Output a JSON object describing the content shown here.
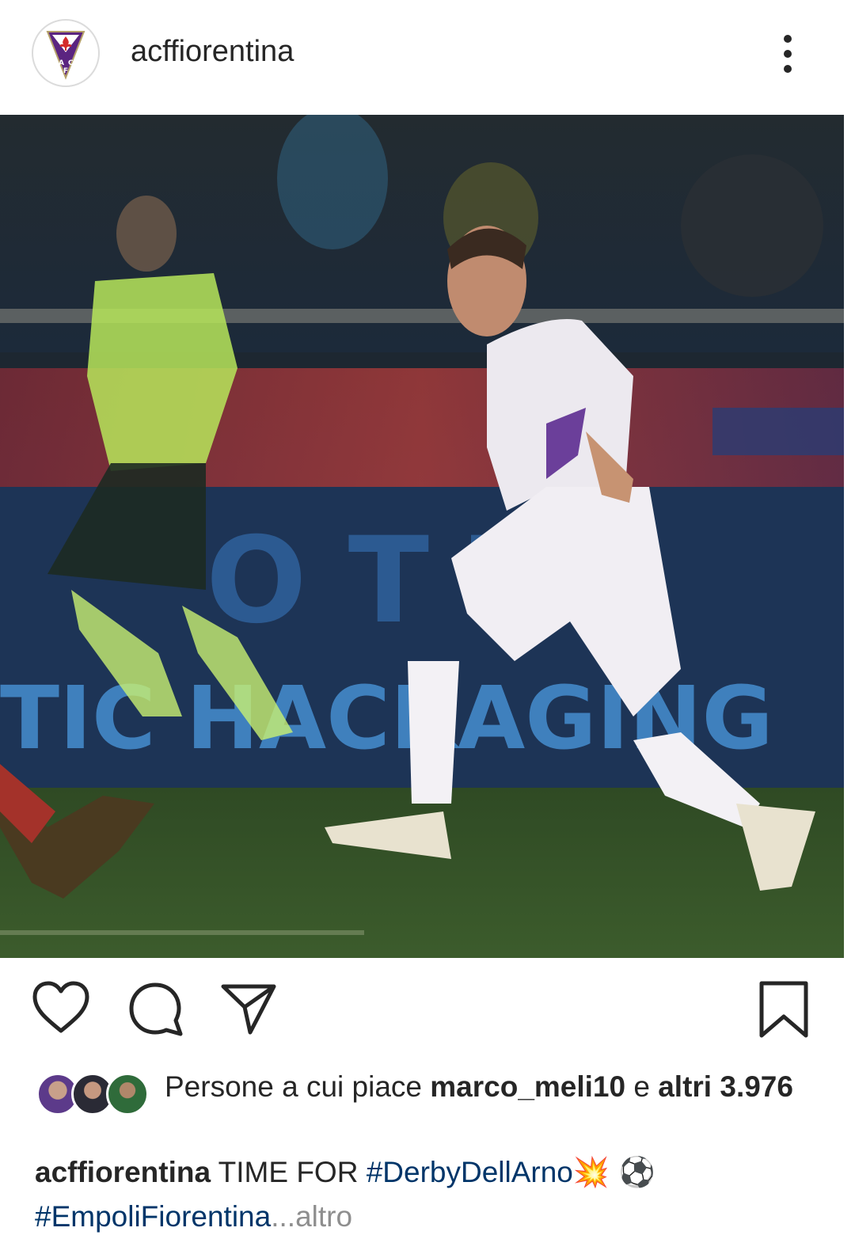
{
  "header": {
    "username": "acffiorentina",
    "avatar_icon": "fiorentina-crest-icon",
    "more_icon": "more-vertical-icon"
  },
  "post": {
    "image_alt": "Fiorentina player in white kit running on pitch",
    "colors": {
      "accent": "#6b2c91",
      "hashtag": "#003569",
      "muted": "#8e8e8e"
    }
  },
  "actions": {
    "like_icon": "heart-icon",
    "comment_icon": "comment-icon",
    "share_icon": "send-icon",
    "save_icon": "bookmark-icon"
  },
  "likes": {
    "prefix": "Persone a cui piace ",
    "user": "marco_meli10",
    "conj": " e ",
    "others": "altri 3.976"
  },
  "caption": {
    "username": "acffiorentina",
    "text": " TIME FOR ",
    "hashtag1": "#DerbyDellArno",
    "emoji1": "💥",
    "emoji2": " ⚽",
    "hashtag2": "#EmpoliFiorentina",
    "ellipsis": "...",
    "more": "altro"
  }
}
